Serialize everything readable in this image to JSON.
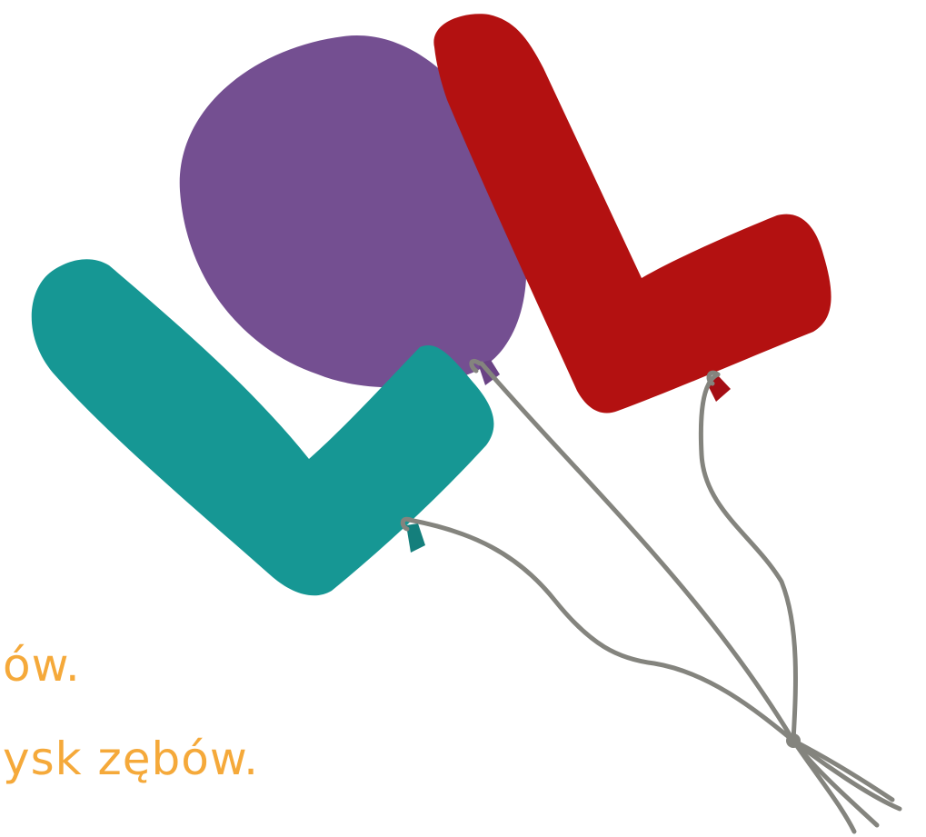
{
  "colors": {
    "background": "#ffffff",
    "text": "#f5a93a",
    "string": "#84847e",
    "balloon_purple": "#744f91",
    "balloon_purple_knot": "#6a4385",
    "balloon_red": "#b31111",
    "balloon_red_knot": "#a40e14",
    "balloon_teal": "#169794",
    "balloon_teal_knot": "#147f7c"
  },
  "text_lines": [
    "ów.",
    "ysk zębów."
  ],
  "illustration": {
    "items": [
      "purple-round-balloon",
      "red-l-shaped-balloon",
      "teal-l-shaped-balloon",
      "balloon-strings"
    ]
  }
}
